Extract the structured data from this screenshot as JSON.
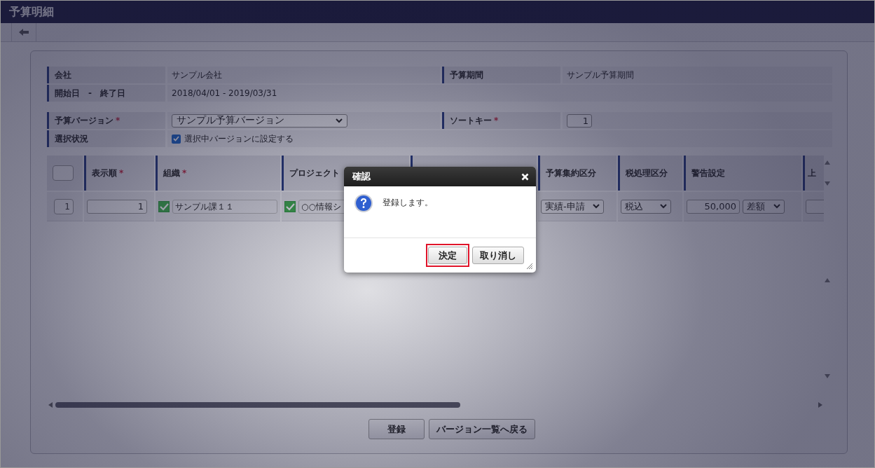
{
  "title": "予算明細",
  "info": [
    {
      "label": "会社",
      "value": "サンプル会社"
    },
    {
      "label": "予算期間",
      "value": "サンプル予算期間"
    },
    {
      "label": "開始日　-　終了日",
      "value": "2018/04/01 - 2019/03/31"
    }
  ],
  "settings": {
    "version": {
      "label": "予算バージョン",
      "mark": "*",
      "value": "サンプル予算バージョン"
    },
    "sort_key": {
      "label": "ソートキー",
      "mark": "*",
      "value": "1"
    },
    "selection": {
      "label": "選択状況",
      "checked": true,
      "text": "選択中バージョンに設定する"
    }
  },
  "table": {
    "select_all": {
      "checked": false
    },
    "columns": [
      {
        "kind": "label",
        "label": "表示順",
        "mark": "*"
      },
      {
        "kind": "label",
        "label": "組織",
        "mark": "*"
      },
      {
        "kind": "label",
        "label": "プロジェクト"
      },
      {
        "kind": "blank"
      },
      {
        "kind": "label",
        "label": "予算集約区分"
      },
      {
        "kind": "label",
        "label": "税処理区分"
      },
      {
        "kind": "label",
        "label": "警告設定"
      },
      {
        "kind": "label",
        "label": "上"
      }
    ],
    "rows": [
      {
        "number": "1",
        "cells": [
          {
            "kind": "input",
            "value": "1"
          },
          {
            "kind": "check-field",
            "checked": true,
            "value": "サンプル課１１"
          },
          {
            "kind": "check-field",
            "checked": true,
            "value": "○○情報シ"
          },
          {
            "kind": "blank"
          },
          {
            "kind": "select",
            "value": "実績-申請"
          },
          {
            "kind": "select",
            "value": "税込"
          },
          {
            "kind": "input-select",
            "value": "50,000",
            "option": "差額"
          },
          {
            "kind": "input"
          }
        ]
      }
    ]
  },
  "dialog": {
    "title": "確認",
    "message": "登録します。",
    "buttons": [
      {
        "label": "決定",
        "highlighted": true
      },
      {
        "label": "取り消し",
        "highlighted": false
      }
    ]
  },
  "buttons": [
    "登録",
    "バージョン一覧へ戻る"
  ]
}
